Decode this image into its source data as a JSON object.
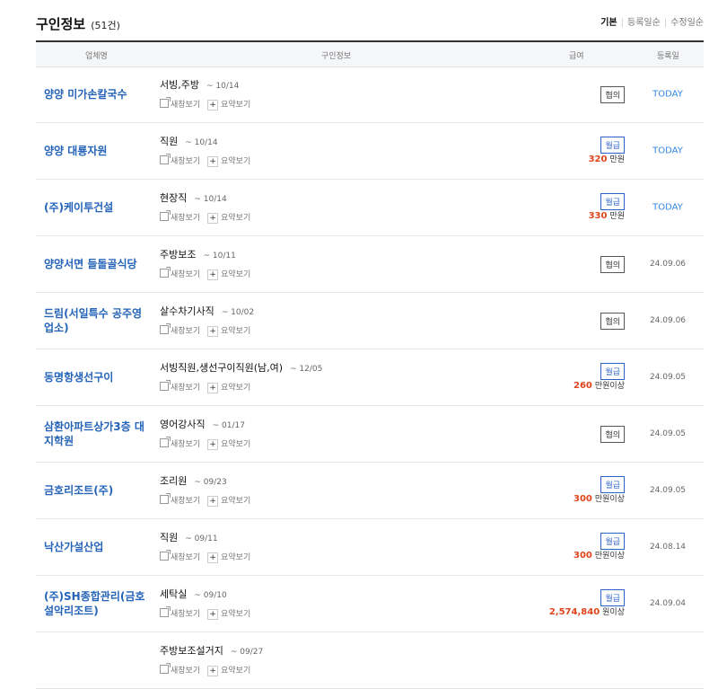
{
  "header": {
    "title": "구인정보",
    "count": "(51건)",
    "sort": {
      "basic": "기본",
      "reg": "등록일순",
      "mod": "수정일순"
    }
  },
  "table": {
    "headers": {
      "company": "업체명",
      "job": "구인정보",
      "pay": "급여",
      "date": "등록일"
    },
    "new_window": "새창보기",
    "summary": "요약보기",
    "rows": [
      {
        "company": "양양 미가손칼국수",
        "job": "서빙,주방",
        "deadline": "~ 10/14",
        "badge": "협의",
        "type": "nego",
        "amount": "",
        "unit": "",
        "date": "TODAY",
        "today": true
      },
      {
        "company": "양양 대룡자원",
        "job": "직원",
        "deadline": "~ 10/14",
        "badge": "월급",
        "type": "monthly",
        "amount": "320",
        "unit": "만원",
        "date": "TODAY",
        "today": true
      },
      {
        "company": "(주)케이투건설",
        "job": "현장직",
        "deadline": "~ 10/14",
        "badge": "월급",
        "type": "monthly",
        "amount": "330",
        "unit": "만원",
        "date": "TODAY",
        "today": true
      },
      {
        "company": "양양서면 들돌골식당",
        "job": "주방보조",
        "deadline": "~ 10/11",
        "badge": "협의",
        "type": "nego",
        "amount": "",
        "unit": "",
        "date": "24.09.06",
        "today": false
      },
      {
        "company": "드림(서일특수 공주영업소)",
        "job": "살수차기사직",
        "deadline": "~ 10/02",
        "badge": "협의",
        "type": "nego",
        "amount": "",
        "unit": "",
        "date": "24.09.06",
        "today": false
      },
      {
        "company": "동명항생선구이",
        "job": "서빙직원,생선구이직원(남,여)",
        "deadline": "~ 12/05",
        "badge": "월급",
        "type": "monthly",
        "amount": "260",
        "unit": "만원이상",
        "date": "24.09.05",
        "today": false
      },
      {
        "company": "삼환아파트상가3층 대지학원",
        "job": "영어강사직",
        "deadline": "~ 01/17",
        "badge": "협의",
        "type": "nego",
        "amount": "",
        "unit": "",
        "date": "24.09.05",
        "today": false
      },
      {
        "company": "금호리조트(주)",
        "job": "조리원",
        "deadline": "~ 09/23",
        "badge": "월급",
        "type": "monthly",
        "amount": "300",
        "unit": "만원이상",
        "date": "24.09.05",
        "today": false
      },
      {
        "company": "낙산가설산업",
        "job": "직원",
        "deadline": "~ 09/11",
        "badge": "월급",
        "type": "monthly",
        "amount": "300",
        "unit": "만원이상",
        "date": "24.08.14",
        "today": false
      },
      {
        "company": "(주)SH종합관리(금호설악리조트)",
        "job": "세탁실",
        "deadline": "~ 09/10",
        "badge": "월급",
        "type": "monthly",
        "amount": "2,574,840",
        "unit": "원이상",
        "date": "24.09.04",
        "today": false
      },
      {
        "company": "",
        "job": "주방보조설거지",
        "deadline": "~ 09/27",
        "badge": "",
        "type": "nego",
        "amount": "",
        "unit": "",
        "date": "",
        "today": false
      }
    ]
  }
}
